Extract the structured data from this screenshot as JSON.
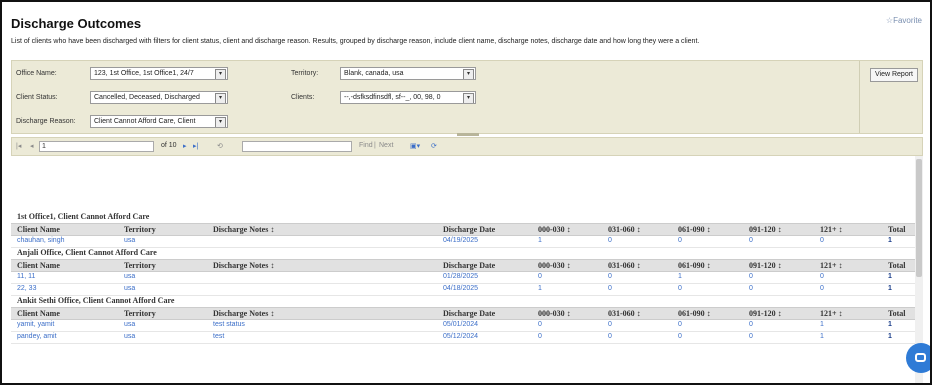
{
  "page": {
    "title": "Discharge Outcomes",
    "favorite": "Favorite",
    "description": "List of clients who have been discharged with filters for client status, client and discharge reason. Results, grouped by discharge reason, include client name, discharge notes, discharge date and how long they were a client."
  },
  "params": {
    "office_label": "Office Name:",
    "office_value": "123, 1st Office, 1st Office1, 24/7",
    "territory_label": "Territory:",
    "territory_value": "Blank, canada, usa",
    "status_label": "Client Status:",
    "status_value": "Cancelled, Deceased, Discharged",
    "clients_label": "Clients:",
    "clients_value": "--,-dsfksdfinsdfl, sf--_, 00, 98, 0",
    "reason_label": "Discharge Reason:",
    "reason_value": "Client Cannot Afford Care, Client",
    "view_report": "View Report"
  },
  "toolbar": {
    "page_value": "1",
    "of_pages": "of 10",
    "find_label": "Find",
    "separator": "|",
    "next_label": "Next"
  },
  "columns": [
    "Client Name",
    "Territory",
    "Discharge Notes",
    "Discharge Date",
    "000-030",
    "031-060",
    "061-090",
    "091-120",
    "121+",
    "Total"
  ],
  "groups": [
    {
      "title": "1st Office1, Client Cannot Afford Care",
      "rows": [
        {
          "name": "chauhan, singh",
          "territory": "usa",
          "notes": "",
          "date": "04/19/2025",
          "b1": "1",
          "b2": "0",
          "b3": "0",
          "b4": "0",
          "b5": "0",
          "total": "1"
        }
      ]
    },
    {
      "title": "Anjali Office, Client Cannot Afford Care",
      "rows": [
        {
          "name": "11, 11",
          "territory": "usa",
          "notes": "",
          "date": "01/28/2025",
          "b1": "0",
          "b2": "0",
          "b3": "1",
          "b4": "0",
          "b5": "0",
          "total": "1"
        },
        {
          "name": "22, 33",
          "territory": "usa",
          "notes": "",
          "date": "04/18/2025",
          "b1": "1",
          "b2": "0",
          "b3": "0",
          "b4": "0",
          "b5": "0",
          "total": "1"
        }
      ]
    },
    {
      "title": "Ankit Sethi Office, Client Cannot Afford Care",
      "rows": [
        {
          "name": "yamit, yamit",
          "territory": "usa",
          "notes": "test status",
          "date": "05/01/2024",
          "b1": "0",
          "b2": "0",
          "b3": "0",
          "b4": "0",
          "b5": "1",
          "total": "1"
        },
        {
          "name": "pandey, amit",
          "territory": "usa",
          "notes": "test",
          "date": "05/12/2024",
          "b1": "0",
          "b2": "0",
          "b3": "0",
          "b4": "0",
          "b5": "1",
          "total": "1"
        }
      ]
    }
  ]
}
